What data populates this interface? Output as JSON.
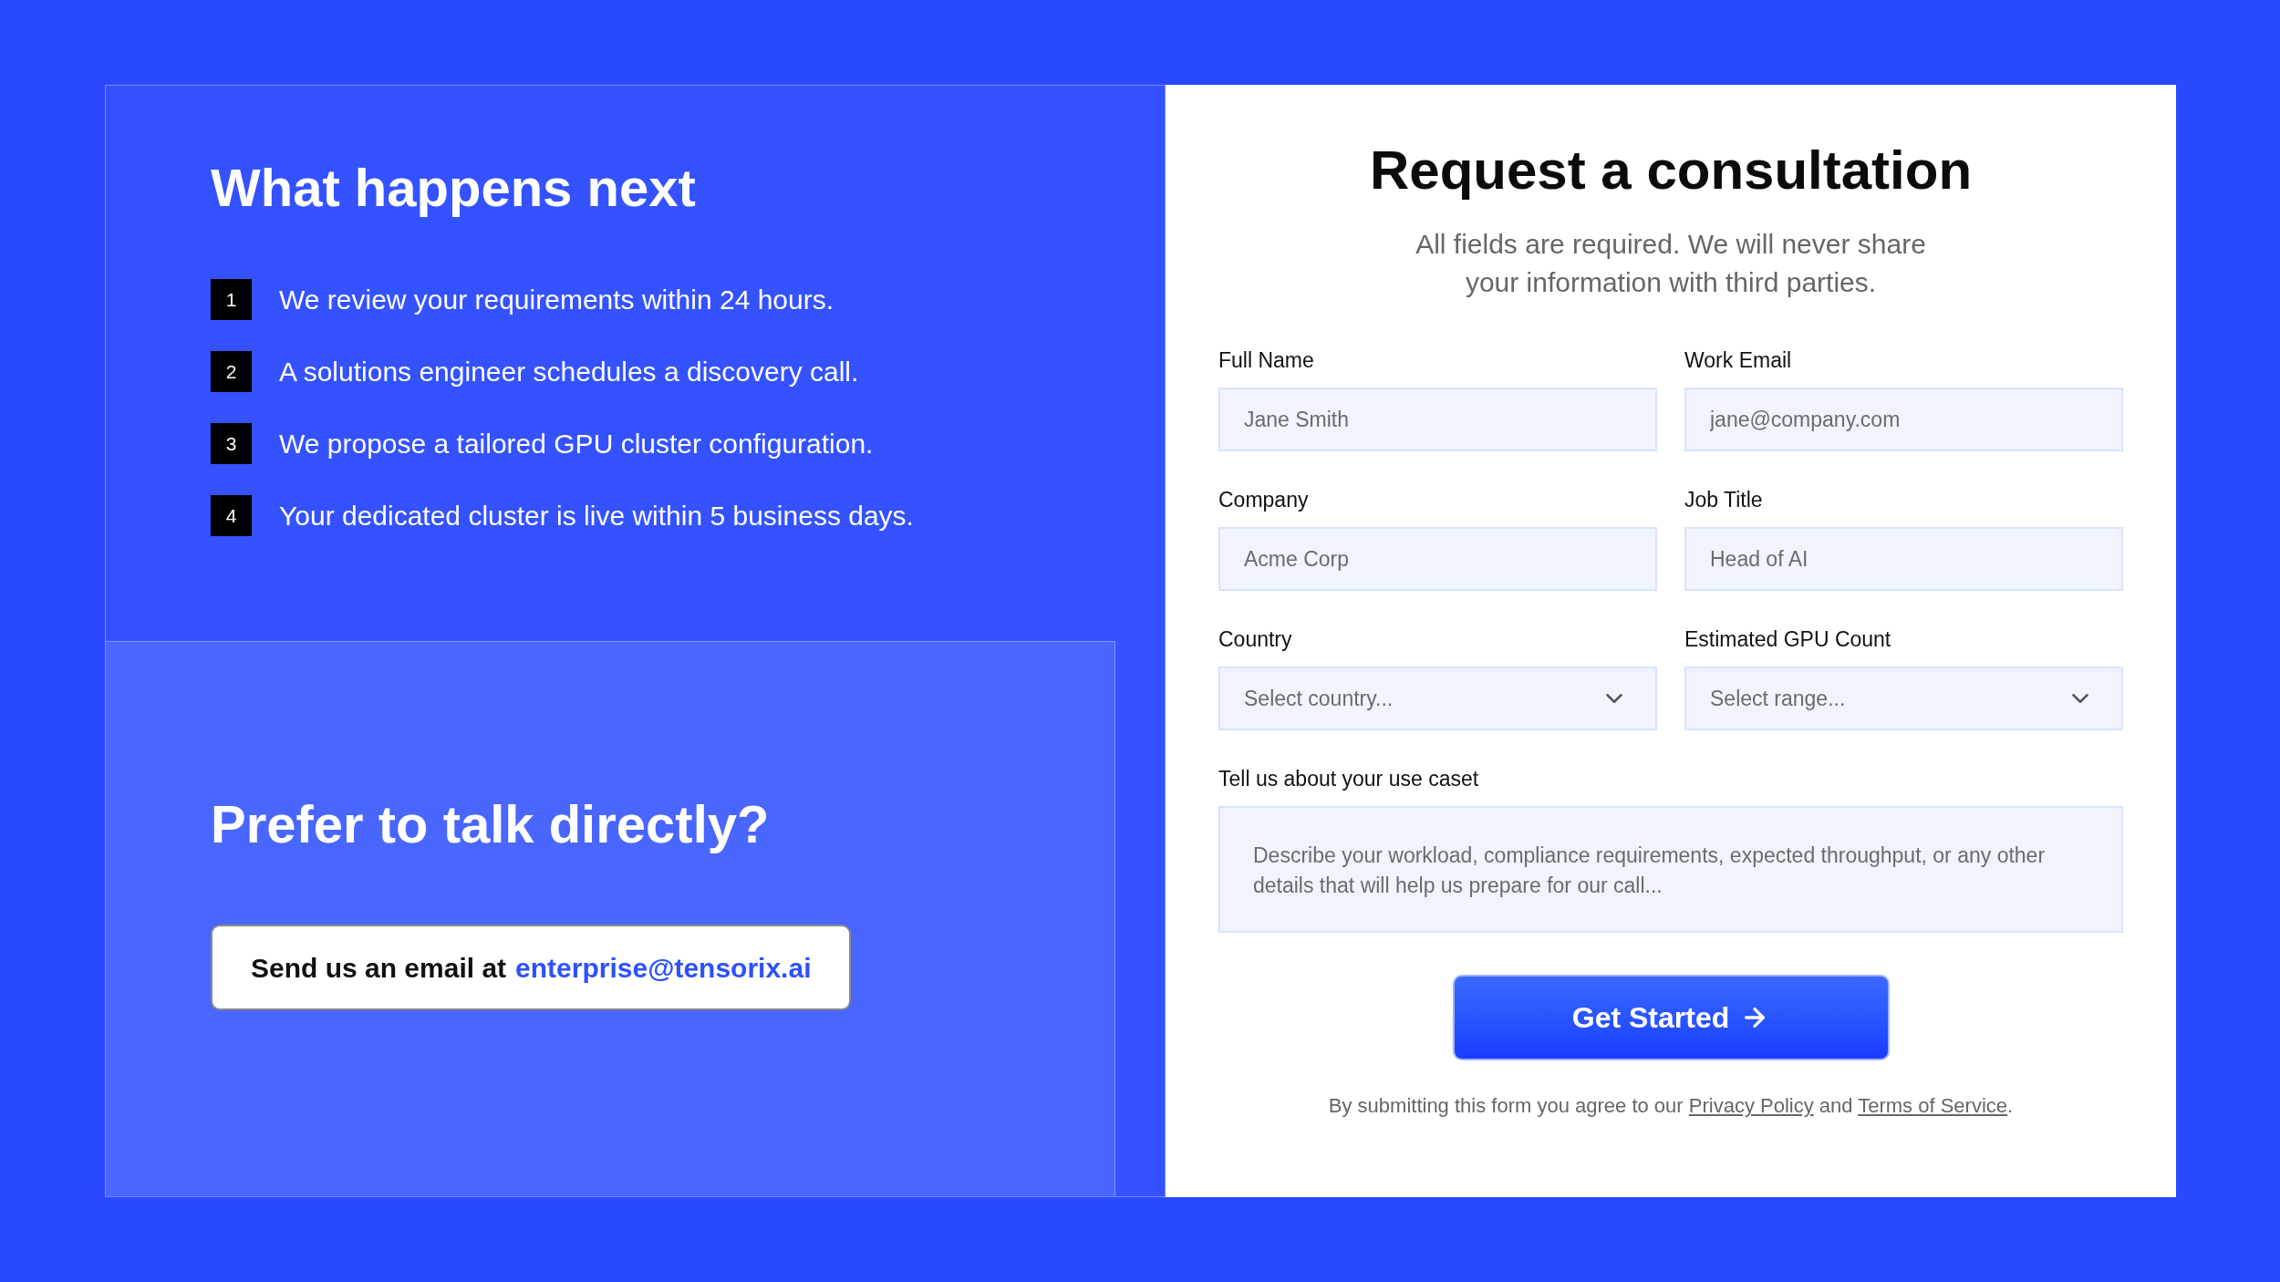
{
  "intro": {
    "heading": "What happens next",
    "steps": [
      {
        "number": "1",
        "text": "We review your requirements within 24 hours."
      },
      {
        "number": "2",
        "text": "A solutions engineer schedules a discovery call."
      },
      {
        "number": "3",
        "text": "We propose a tailored GPU cluster configuration."
      },
      {
        "number": "4",
        "text": "Your dedicated cluster is live within 5 business days."
      }
    ]
  },
  "contact": {
    "heading": "Prefer to talk directly?",
    "prompt": "Send us an email at",
    "email": "enterprise@tensorix.ai"
  },
  "form": {
    "title": "Request a consultation",
    "subtitle": "All fields are required. We will never share your information with third parties.",
    "fields": [
      {
        "kind": "text",
        "label": "Full Name",
        "placeholder": "Jane Smith"
      },
      {
        "kind": "text",
        "label": "Work Email",
        "placeholder": "jane@company.com"
      },
      {
        "kind": "text",
        "label": "Company",
        "placeholder": "Acme Corp"
      },
      {
        "kind": "text",
        "label": "Job Title",
        "placeholder": "Head of AI"
      },
      {
        "kind": "select",
        "label": "Country",
        "placeholder": "Select country..."
      },
      {
        "kind": "select",
        "label": "Estimated GPU Count",
        "placeholder": "Select range..."
      },
      {
        "kind": "textarea",
        "label": "Tell us about your use caset",
        "placeholder": "Describe your workload, compliance requirements, expected throughput, or any other details that will help us prepare for our call..."
      }
    ],
    "submit": "Get Started",
    "legal": [
      {
        "kind": "text",
        "text": "By submitting this form you agree to our "
      },
      {
        "kind": "link",
        "text": "Privacy Policy"
      },
      {
        "kind": "text",
        "text": " and "
      },
      {
        "kind": "link",
        "text": "Terms of Service"
      },
      {
        "kind": "text",
        "text": "."
      }
    ]
  }
}
